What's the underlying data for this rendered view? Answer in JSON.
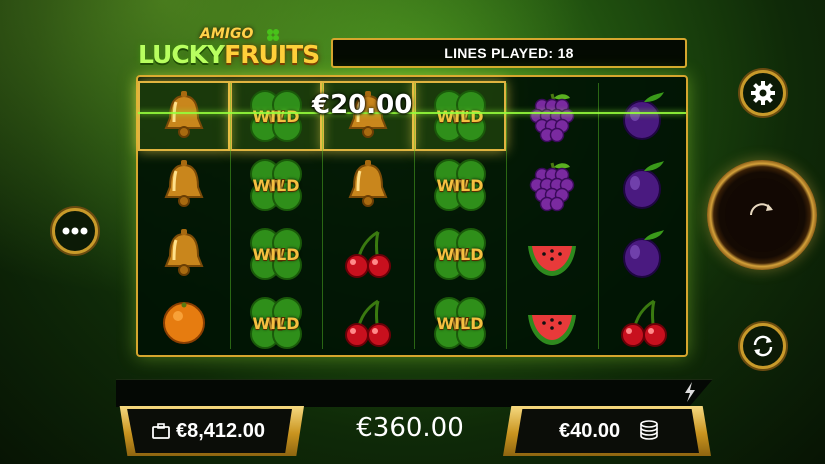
{
  "logo": {
    "top_text": "AMIGO",
    "left_text": "LUCKY",
    "right_text": "FRUITS"
  },
  "lines_played": "LINES PLAYED: 18",
  "win_amount": "€20.00",
  "wild_label": "WILD",
  "reels": [
    [
      "bell",
      "bell",
      "bell",
      "orange"
    ],
    [
      "wild",
      "wild",
      "wild",
      "wild"
    ],
    [
      "bell",
      "bell",
      "cherry",
      "cherry"
    ],
    [
      "wild",
      "wild",
      "wild",
      "wild"
    ],
    [
      "grapes",
      "grapes",
      "watermelon",
      "watermelon"
    ],
    [
      "plum",
      "plum",
      "plum",
      "cherry"
    ]
  ],
  "highlighted_cells": [
    [
      0,
      0
    ],
    [
      1,
      0
    ],
    [
      2,
      0
    ],
    [
      3,
      0
    ]
  ],
  "balance": "€8,412.00",
  "total_win": "€360.00",
  "bet": "€40.00",
  "icons": {
    "settings": "gear-icon",
    "menu": "more-dots-icon",
    "spin": "spin-arrow-icon",
    "autoplay": "autoplay-icon",
    "balance": "briefcase-icon",
    "bet": "coin-stack-icon",
    "turbo": "lightning-icon"
  },
  "colors": {
    "gold": "#d6a62e",
    "green_glow": "#96ff3c",
    "panel": "#040a02"
  }
}
